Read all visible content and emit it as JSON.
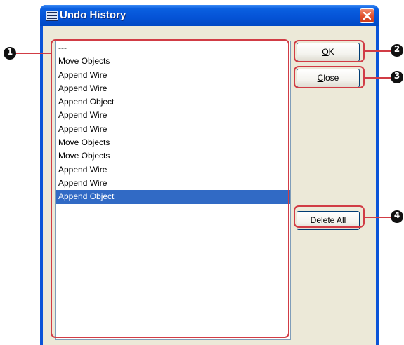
{
  "window": {
    "title": "Undo History",
    "icon": "dme-app-icon",
    "close_icon": "close-icon"
  },
  "history": {
    "items": [
      "---",
      "Move Objects",
      "Append Wire",
      "Append Wire",
      "Append Object",
      "Append Wire",
      "Append Wire",
      "Move Objects",
      "Move Objects",
      "Append Wire",
      "Append Wire",
      "Append Object"
    ],
    "selected_index": 11
  },
  "buttons": {
    "ok": {
      "accel": "O",
      "rest": "K"
    },
    "close": {
      "accel": "C",
      "rest": "lose"
    },
    "delete_all": {
      "accel": "D",
      "rest": "elete All"
    }
  },
  "callouts": {
    "list": "1",
    "ok": "2",
    "close": "3",
    "delete_all": "4"
  },
  "colors": {
    "highlight": "#d13c45",
    "selection": "#316ac5",
    "titlebar": "#0553d6",
    "client": "#ece9d8"
  }
}
